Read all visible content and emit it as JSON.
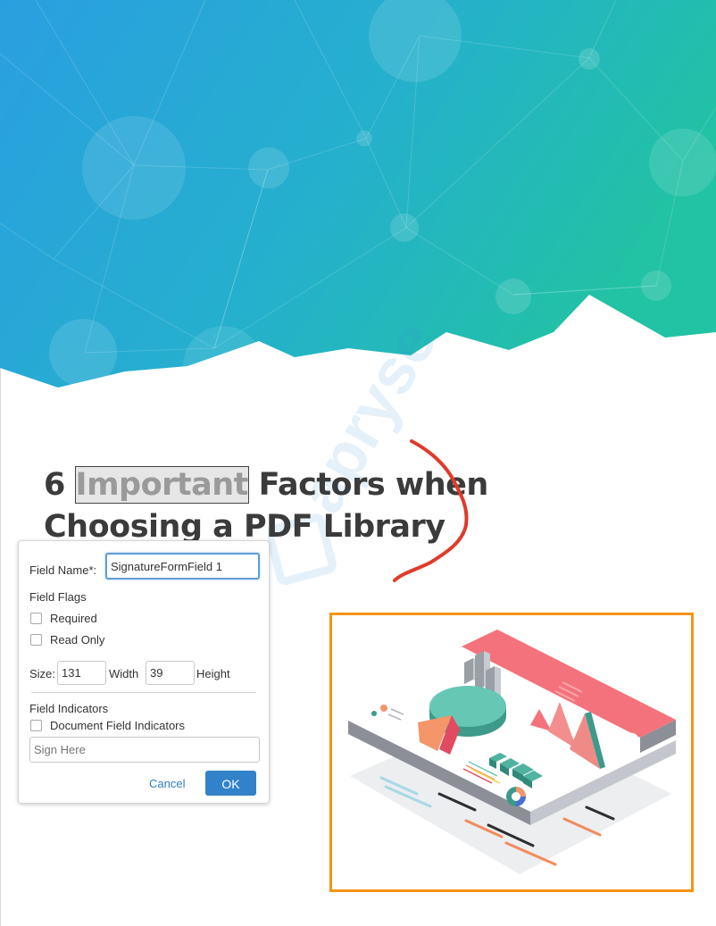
{
  "document": {
    "title_prefix": "6 ",
    "title_highlight": "Important",
    "title_suffix": " Factors when",
    "title_line2": "Choosing a PDF Library",
    "watermark_text": "apryse"
  },
  "colors": {
    "hero_gradient": [
      "#2a9fe0",
      "#25b6c3",
      "#23c1a6"
    ],
    "ink_annotation": "#e03a2a",
    "frame_border": "#f39416",
    "primary_button": "#3182c9"
  },
  "dialog": {
    "field_name_label": "Field Name*:",
    "field_name_value": "SignatureFormField 1",
    "flags_heading": "Field Flags",
    "required_label": "Required",
    "required_checked": false,
    "read_only_label": "Read Only",
    "read_only_checked": false,
    "size_label": "Size:",
    "width_value": "131",
    "width_label": "Width",
    "height_value": "39",
    "height_label": "Height",
    "indicators_heading": "Field Indicators",
    "doc_indicators_label": "Document Field Indicators",
    "doc_indicators_checked": false,
    "sign_here_placeholder": "Sign Here",
    "cancel_label": "Cancel",
    "ok_label": "OK"
  }
}
